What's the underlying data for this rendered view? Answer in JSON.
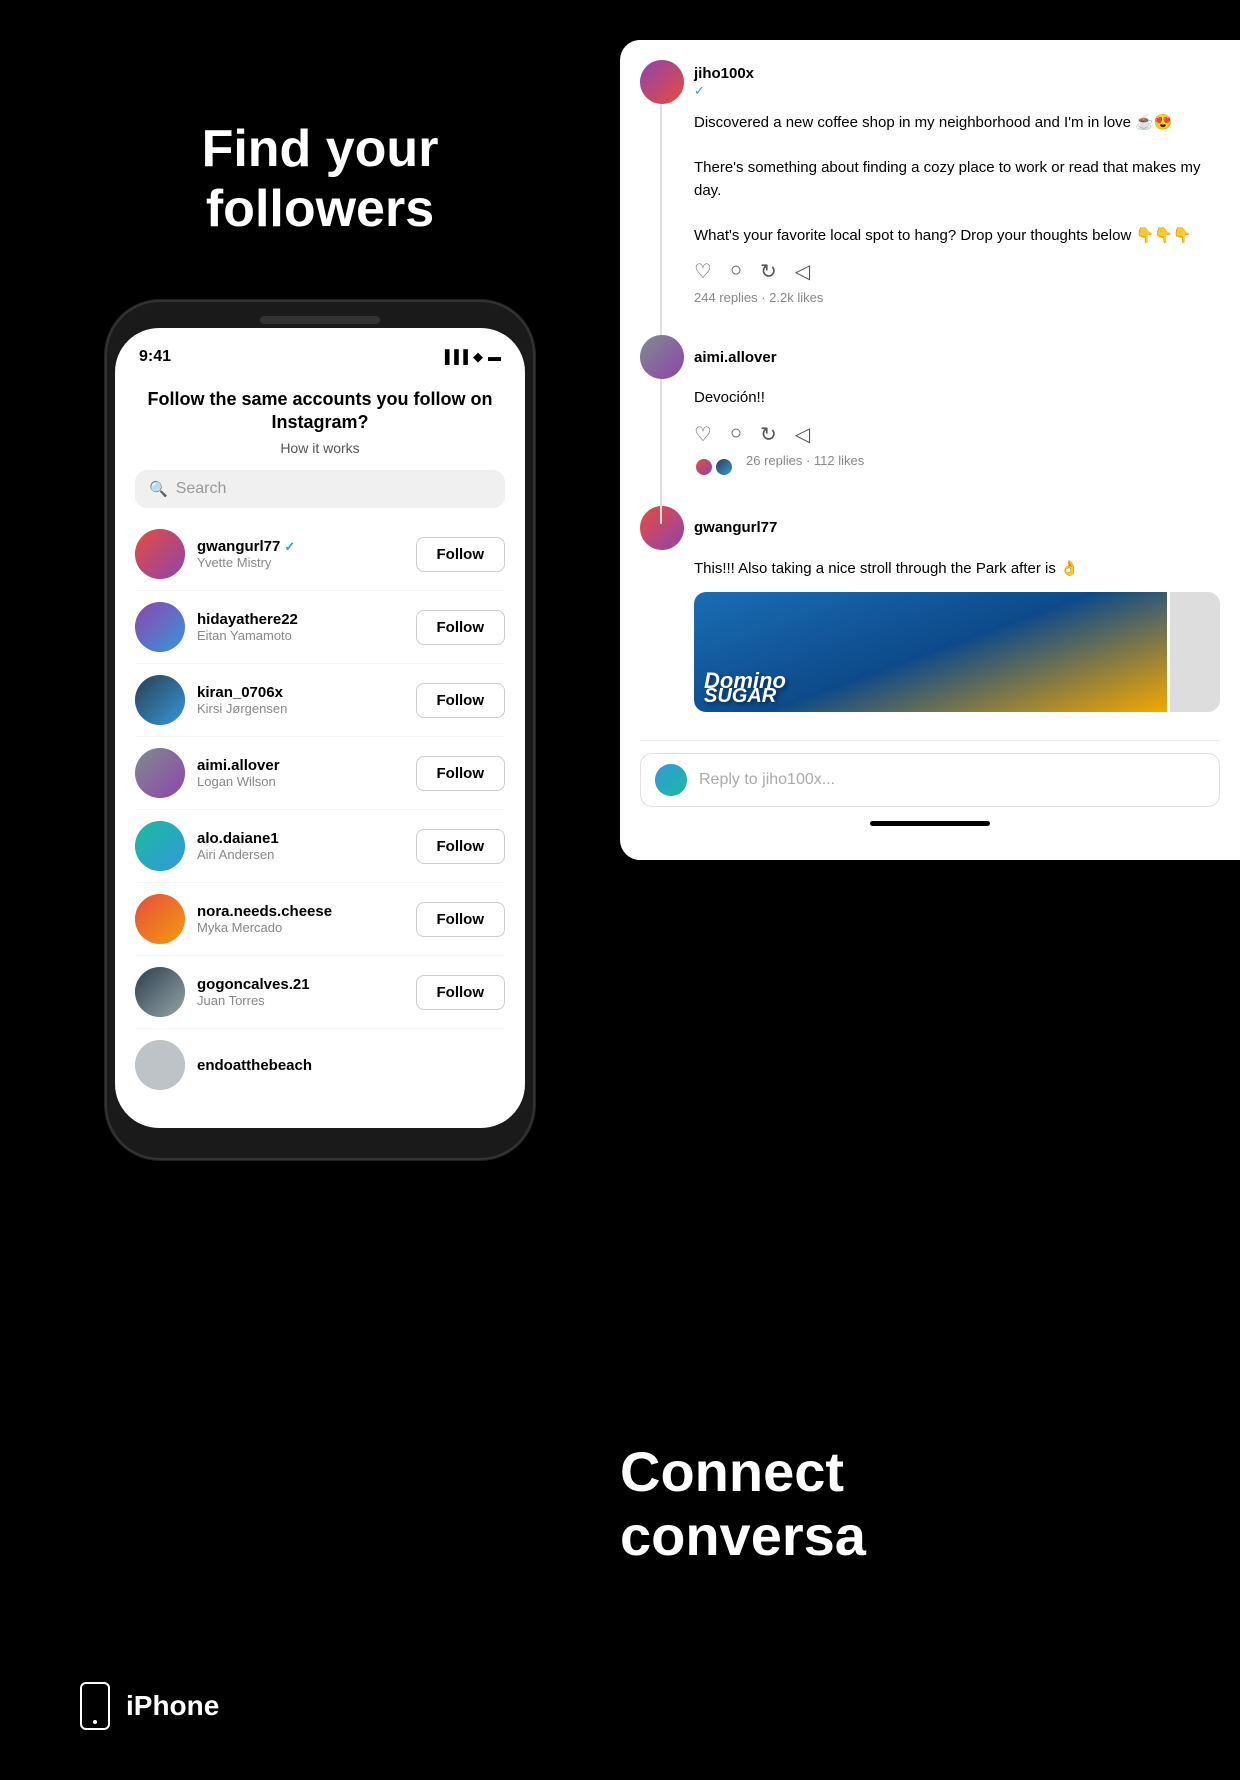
{
  "page": {
    "background": "#000000"
  },
  "left": {
    "headline": "Find your followers",
    "phone": {
      "status_time": "9:41",
      "status_signals": "▐▐▐ ◆ ▬",
      "screen_title": "Follow the same accounts you follow on Instagram?",
      "how_it_works": "How it works",
      "search_placeholder": "Search",
      "users": [
        {
          "handle": "gwangurl77",
          "name": "Yvette Mistry",
          "verified": true,
          "avatar_class": "avatar-1"
        },
        {
          "handle": "hidayathere22",
          "name": "Eitan Yamamoto",
          "verified": false,
          "avatar_class": "avatar-2"
        },
        {
          "handle": "kiran_0706x",
          "name": "Kirsi Jørgensen",
          "verified": false,
          "avatar_class": "avatar-3"
        },
        {
          "handle": "aimi.allover",
          "name": "Logan Wilson",
          "verified": false,
          "avatar_class": "avatar-4"
        },
        {
          "handle": "alo.daiane1",
          "name": "Airi Andersen",
          "verified": false,
          "avatar_class": "avatar-5"
        },
        {
          "handle": "nora.needs.cheese",
          "name": "Myka Mercado",
          "verified": false,
          "avatar_class": "avatar-6"
        },
        {
          "handle": "gogoncalves.21",
          "name": "Juan Torres",
          "verified": false,
          "avatar_class": "avatar-7"
        },
        {
          "handle": "endoatthebeach",
          "name": "",
          "verified": false,
          "avatar_class": "avatar-8"
        }
      ],
      "follow_label": "Follow"
    },
    "iphone_label": "iPhone"
  },
  "right": {
    "posts": [
      {
        "username": "jiho100x",
        "verified": true,
        "body_line1": "Discovered a new coffee shop in my neighborhood and I'm in love ☕😍",
        "body_line2": "There's something about finding a cozy place to work or read that makes my day.",
        "body_line3": "What's your favorite local spot to hang? Drop your thoughts below 👇👇👇",
        "stats": "244 replies · 2.2k likes"
      },
      {
        "username": "aimi.allover",
        "verified": false,
        "body": "Devoción!!",
        "stats": "26 replies · 112 likes"
      },
      {
        "username": "gwangurl77",
        "verified": false,
        "body": "This!!! Also taking a nice stroll through the Park after is 👌"
      }
    ],
    "reply_placeholder": "Reply to jiho100x...",
    "connect_headline": "Connect\nconversa"
  }
}
